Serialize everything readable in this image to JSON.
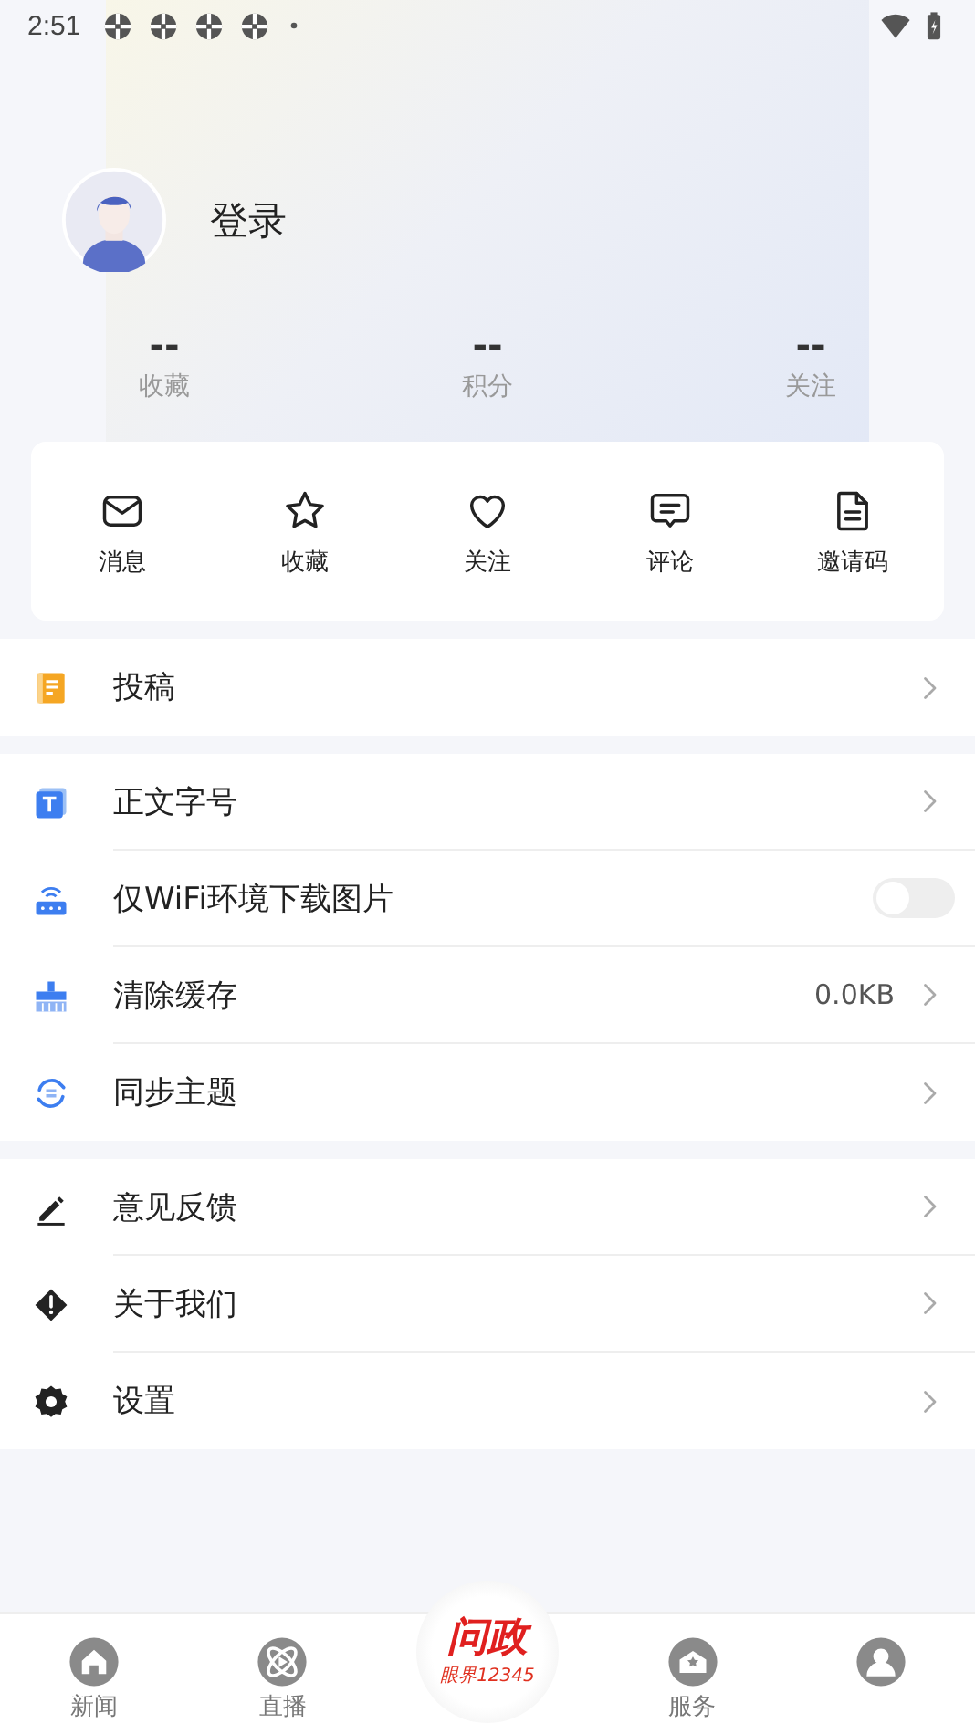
{
  "status_bar": {
    "time": "2:51"
  },
  "profile": {
    "name": "登录"
  },
  "stats": [
    {
      "value": "--",
      "label": "收藏"
    },
    {
      "value": "--",
      "label": "积分"
    },
    {
      "value": "--",
      "label": "关注"
    }
  ],
  "actions": [
    {
      "label": "消息"
    },
    {
      "label": "收藏"
    },
    {
      "label": "关注"
    },
    {
      "label": "评论"
    },
    {
      "label": "邀请码"
    }
  ],
  "menu_groups": [
    [
      {
        "label": "投稿",
        "kind": "link"
      }
    ],
    [
      {
        "label": "正文字号",
        "kind": "link"
      },
      {
        "label": "仅WiFi环境下载图片",
        "kind": "toggle",
        "on": false
      },
      {
        "label": "清除缓存",
        "kind": "link",
        "value": "0.0KB"
      },
      {
        "label": "同步主题",
        "kind": "link"
      }
    ],
    [
      {
        "label": "意见反馈",
        "kind": "link"
      },
      {
        "label": "关于我们",
        "kind": "link"
      },
      {
        "label": "设置",
        "kind": "link"
      }
    ]
  ],
  "bottom_nav": [
    {
      "label": "新闻",
      "kind": "tab"
    },
    {
      "label": "直播",
      "kind": "tab"
    },
    {
      "kind": "center",
      "title": "问政",
      "subtitle": "眼界12345"
    },
    {
      "label": "服务",
      "kind": "tab"
    },
    {
      "kind": "tab"
    }
  ]
}
